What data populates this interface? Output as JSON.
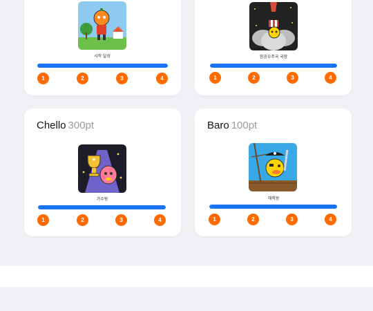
{
  "colors": {
    "accent_blue": "#1a73f5",
    "step_orange": "#ff6b00",
    "background": "#f0f1f4"
  },
  "cards": [
    {
      "name": "",
      "points": "",
      "caption": "시작 달성",
      "progress": 1.0,
      "steps": [
        "1",
        "2",
        "3",
        "4"
      ],
      "art": "pumpkin-character"
    },
    {
      "name": "",
      "points": "",
      "caption": "항공우주국 국장",
      "progress": 1.0,
      "steps": [
        "1",
        "2",
        "3",
        "4"
      ],
      "art": "rocket-character"
    },
    {
      "name": "Chello",
      "points": "300pt",
      "caption": "가수왕",
      "progress": 1.0,
      "steps": [
        "1",
        "2",
        "3",
        "4"
      ],
      "art": "trophy-character"
    },
    {
      "name": "Baro",
      "points": "100pt",
      "caption": "해적왕",
      "progress": 1.0,
      "steps": [
        "1",
        "2",
        "3",
        "4"
      ],
      "art": "pirate-character"
    }
  ]
}
